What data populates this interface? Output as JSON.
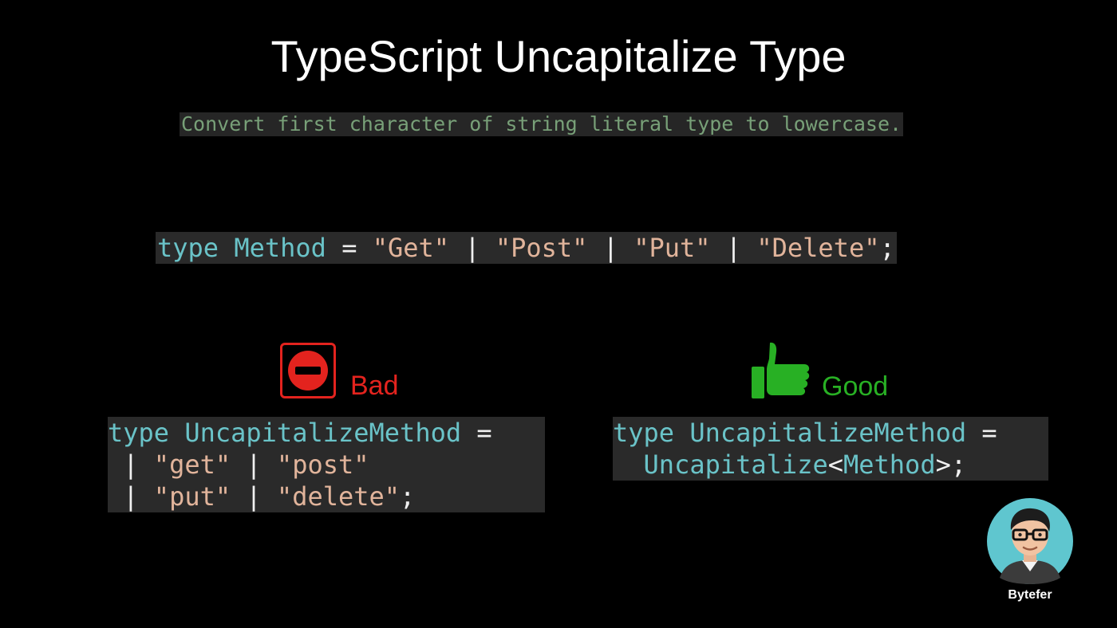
{
  "title": "TypeScript Uncapitalize Type",
  "subtitle": "Convert first character of string literal type to lowercase.",
  "main_code": {
    "kw": "type",
    "name": "Method",
    "eq": " = ",
    "s1": "\"Get\"",
    "s2": "\"Post\"",
    "s3": "\"Put\"",
    "s4": "\"Delete\"",
    "sep": " | ",
    "end": ";"
  },
  "bad": {
    "label": "Bad",
    "icon": "no-entry-icon",
    "code": {
      "kw": "type",
      "name": "UncapitalizeMethod",
      "eq": " =",
      "s1": "\"get\"",
      "s2": "\"post\"",
      "s3": "\"put\"",
      "s4": "\"delete\"",
      "end": ";"
    }
  },
  "good": {
    "label": "Good",
    "icon": "thumbs-up-icon",
    "code": {
      "kw": "type",
      "name": "UncapitalizeMethod",
      "eq": " =",
      "fn": "Uncapitalize",
      "lt": "<",
      "arg": "Method",
      "gt": ">",
      "end": ";"
    }
  },
  "brand": "Bytefer",
  "colors": {
    "background": "#000000",
    "keyword": "#6ac3c8",
    "string": "#e1b49b",
    "bad": "#e3231e",
    "good": "#28b024",
    "comment": "#78a078"
  }
}
